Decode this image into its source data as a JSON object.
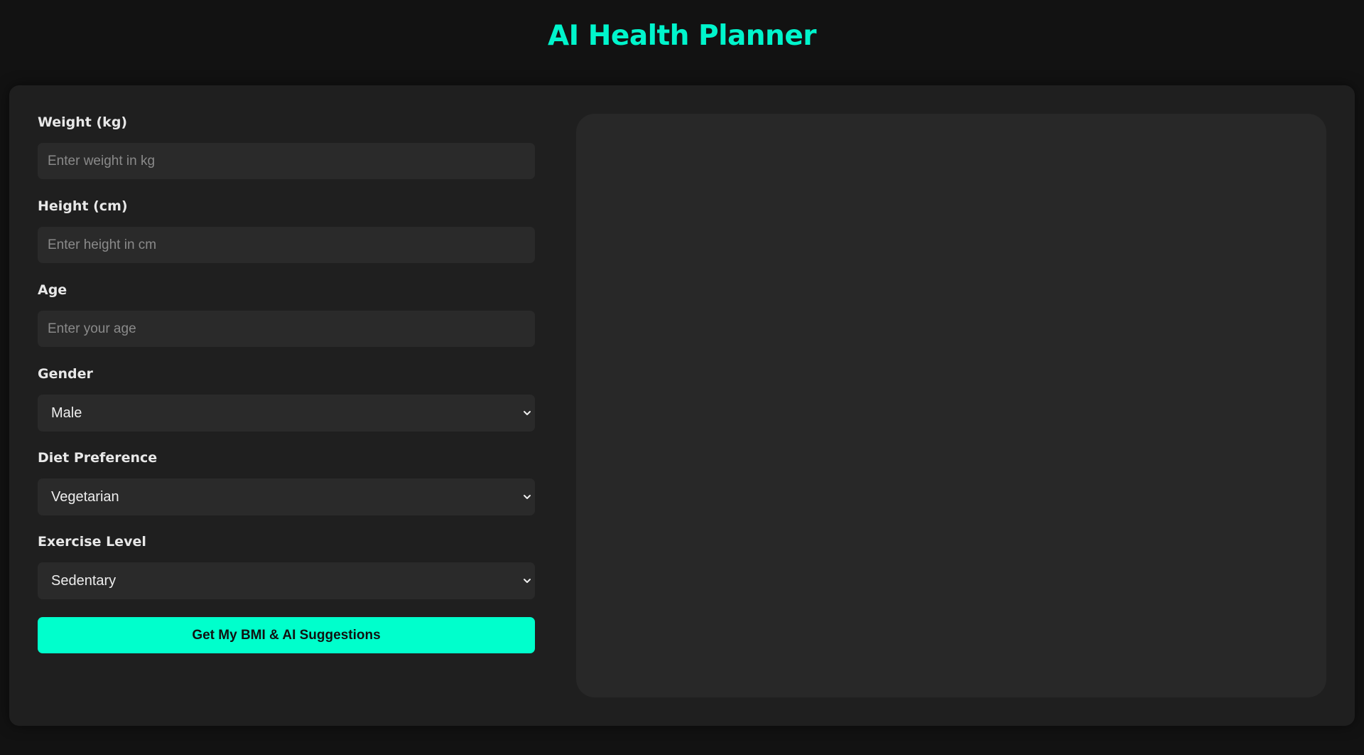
{
  "header": {
    "title": "AI Health Planner"
  },
  "form": {
    "weight": {
      "label": "Weight (kg)",
      "placeholder": "Enter weight in kg",
      "value": ""
    },
    "height": {
      "label": "Height (cm)",
      "placeholder": "Enter height in cm",
      "value": ""
    },
    "age": {
      "label": "Age",
      "placeholder": "Enter your age",
      "value": ""
    },
    "gender": {
      "label": "Gender",
      "selected": "Male",
      "icon": "chevron-down-icon"
    },
    "diet": {
      "label": "Diet Preference",
      "selected": "Vegetarian",
      "icon": "chevron-down-icon"
    },
    "exercise": {
      "label": "Exercise Level",
      "selected": "Sedentary",
      "icon": "chevron-down-icon"
    },
    "submit_label": "Get My BMI & AI Suggestions"
  },
  "results": {
    "content": ""
  },
  "colors": {
    "accent": "#00ffcc",
    "title": "#00f5cc",
    "background": "#121212",
    "card": "#1f1f1f",
    "input": "#2a2a2a",
    "panel": "#282828"
  }
}
